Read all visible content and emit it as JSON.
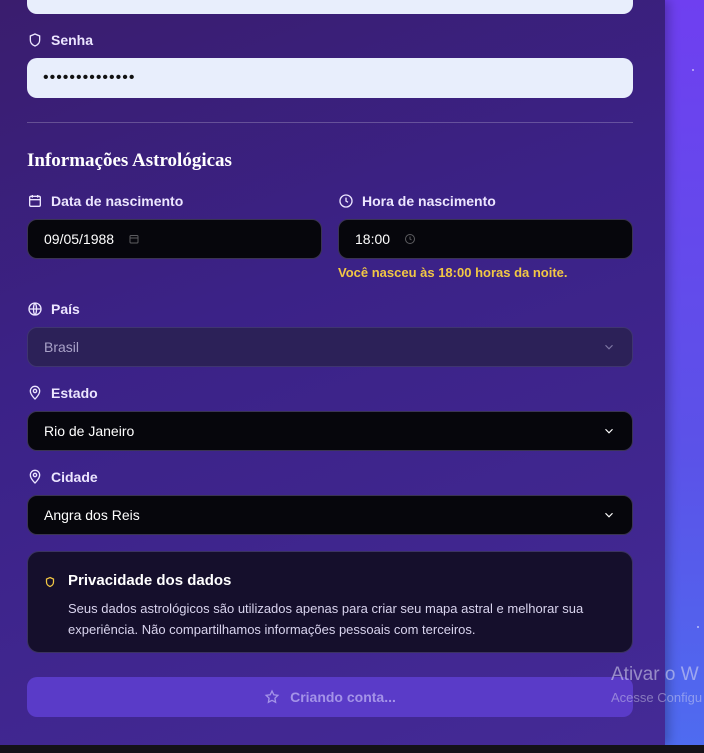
{
  "form": {
    "password": {
      "label": "Senha",
      "value": "••••••••••••••",
      "icon": "shield-icon"
    },
    "section_title": "Informações Astrológicas",
    "birth_date": {
      "label": "Data de nascimento",
      "value": "09/05/1988",
      "icon": "calendar-icon"
    },
    "birth_time": {
      "label": "Hora de nascimento",
      "value": "18:00",
      "icon": "clock-icon"
    },
    "time_note": "Você nasceu às 18:00 horas da noite.",
    "country": {
      "label": "País",
      "value": "Brasil",
      "icon": "globe-icon",
      "disabled": true
    },
    "state": {
      "label": "Estado",
      "value": "Rio de Janeiro",
      "icon": "map-pin-icon"
    },
    "city": {
      "label": "Cidade",
      "value": "Angra dos Reis",
      "icon": "map-pin-icon"
    }
  },
  "privacy": {
    "title": "Privacidade dos dados",
    "text": "Seus dados astrológicos são utilizados apenas para criar seu mapa astral e melhorar sua experiência. Não compartilhamos informações pessoais com terceiros.",
    "icon": "shield-icon"
  },
  "submit": {
    "label": "Criando conta...",
    "icon": "star-icon"
  },
  "watermark": {
    "title": "Ativar o W",
    "subtitle": "Acesse Configu"
  },
  "colors": {
    "accent": "#5a3bc8",
    "note": "#f2c744",
    "input_light": "#e8eefc",
    "input_dark": "#06060c"
  }
}
